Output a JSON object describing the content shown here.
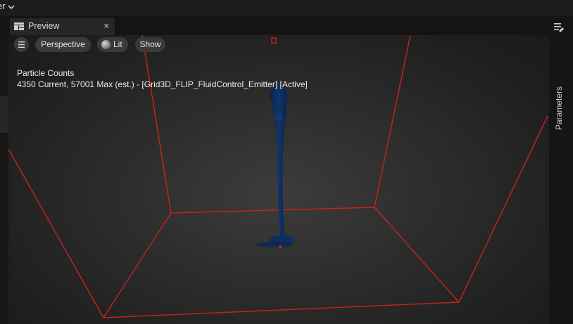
{
  "topbar": {
    "label": "er",
    "chevron_icon": "chevron-down-icon"
  },
  "tab": {
    "label": "Preview",
    "icon": "viewport-layout-icon",
    "close_label": "×"
  },
  "viewport": {
    "toolbar": {
      "menu_icon": "hamburger-menu-icon",
      "perspective_label": "Perspective",
      "lit_label": "Lit",
      "lit_icon": "lit-sphere-icon",
      "show_label": "Show"
    },
    "stats": {
      "title": "Particle Counts",
      "line": "4350 Current, 57001 Max (est.) - [Grid3D_FLIP_FluidControl_Emitter] [Active]"
    },
    "bounds_color": "#c8231e",
    "fluid_color": "#0c2a5c"
  },
  "right_panel": {
    "label": "Parameters",
    "icon": "parameters-sliders-icon"
  }
}
